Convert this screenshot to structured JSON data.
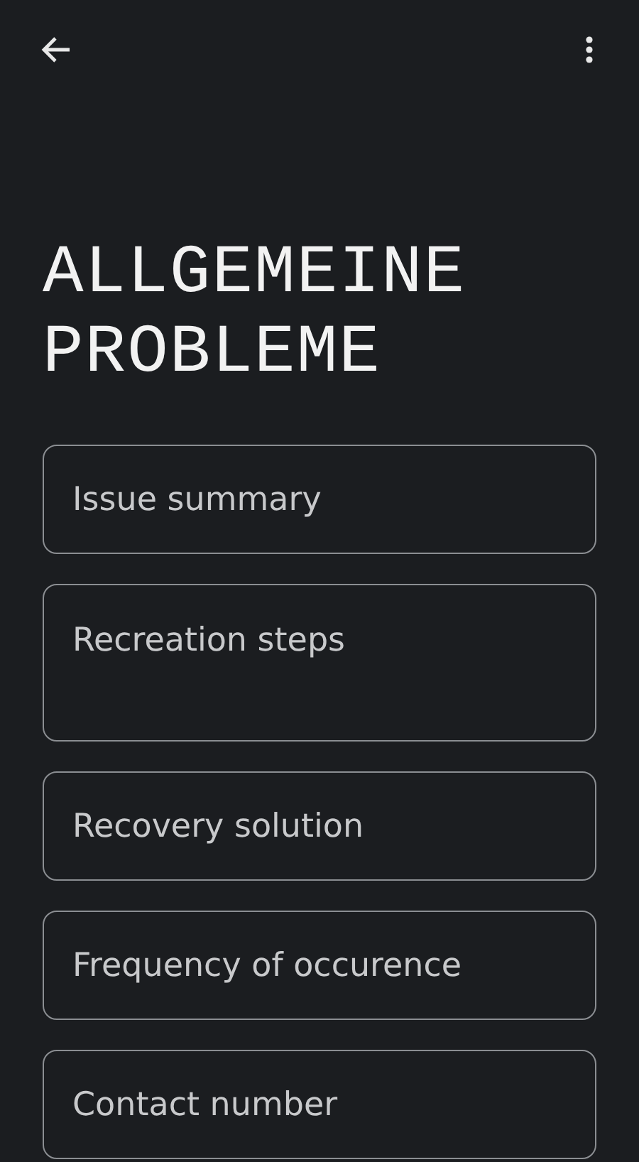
{
  "title": "ALLGEMEINE PROBLEME",
  "fields": [
    {
      "kind": "text",
      "placeholder": "Issue summary"
    },
    {
      "kind": "multiline",
      "placeholder": "Recreation steps"
    },
    {
      "kind": "text",
      "placeholder": "Recovery solution"
    },
    {
      "kind": "text",
      "placeholder": "Frequency of occurence"
    },
    {
      "kind": "text",
      "placeholder": "Contact number"
    }
  ]
}
